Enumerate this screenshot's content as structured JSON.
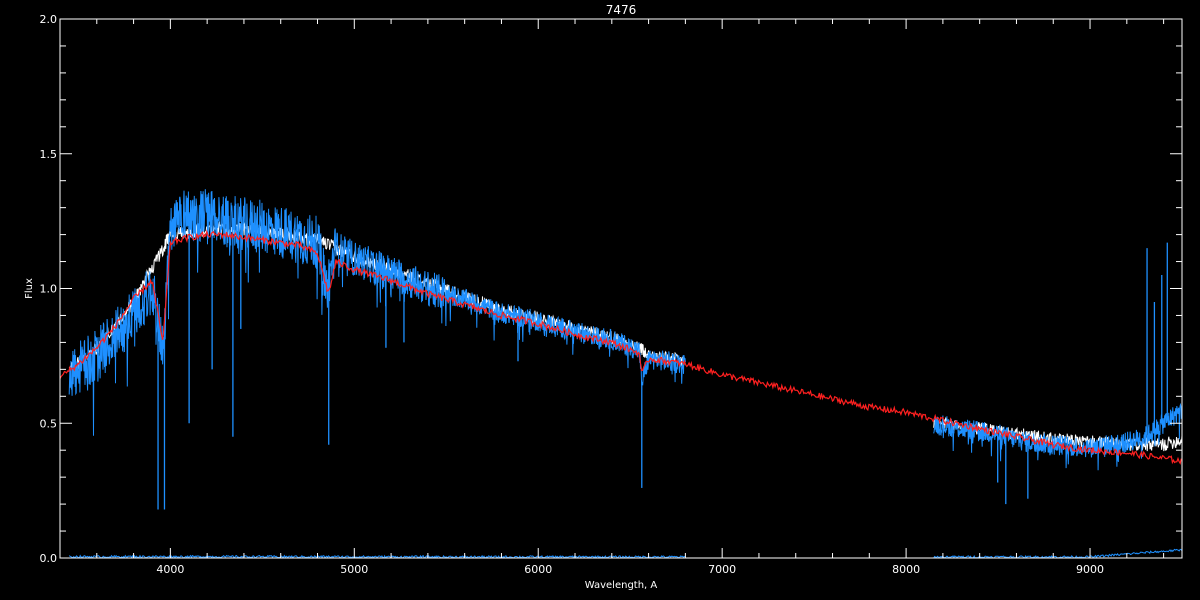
{
  "chart_data": {
    "type": "line",
    "title": "7476",
    "xlabel": "Wavelength, A",
    "ylabel": "Flux",
    "xlim": [
      3400,
      9500
    ],
    "ylim": [
      0.0,
      2.0
    ],
    "x_ticks": [
      4000,
      5000,
      6000,
      7000,
      8000,
      9000
    ],
    "x_tick_labels": [
      "4000",
      "5000",
      "6000",
      "7000",
      "8000",
      "9000"
    ],
    "y_ticks": [
      0.0,
      0.5,
      1.0,
      1.5,
      2.0
    ],
    "y_tick_labels": [
      "0.0",
      "0.5",
      "1.0",
      "1.5",
      "2.0"
    ],
    "grid": false,
    "colors": {
      "background": "#000000",
      "axes": "#ffffff",
      "observed": "#1e90ff",
      "model": "#ff2020",
      "white_spectrum": "#ffffff",
      "error": "#1e90ff"
    },
    "series": [
      {
        "style": "white",
        "segments": [
          {
            "x": [
              3450,
              3600,
              3800,
              4000,
              4200,
              4400,
              4600,
              4800,
              5000,
              5200,
              5400,
              5600,
              5800,
              6000,
              6200,
              6400,
              6550,
              6600,
              6700,
              6800
            ],
            "y": [
              0.7,
              0.78,
              0.95,
              1.2,
              1.22,
              1.22,
              1.2,
              1.18,
              1.12,
              1.07,
              1.02,
              0.97,
              0.92,
              0.89,
              0.85,
              0.82,
              0.78,
              0.75,
              0.74,
              0.73
            ]
          },
          {
            "x": [
              8150,
              8400,
              8600,
              8800,
              9000,
              9200,
              9400,
              9500
            ],
            "y": [
              0.5,
              0.48,
              0.46,
              0.44,
              0.43,
              0.42,
              0.42,
              0.44
            ]
          }
        ]
      },
      {
        "style": "blue",
        "segments": [
          {
            "x": [
              3450,
              3600,
              3800,
              3900,
              3960,
              4000,
              4050,
              4150,
              4200,
              4300,
              4400,
              4500,
              4600,
              4700,
              4800,
              4850,
              4900,
              5000,
              5200,
              5400,
              5600,
              5800,
              6000,
              6200,
              6400,
              6550,
              6562,
              6600,
              6700,
              6800
            ],
            "y": [
              0.68,
              0.75,
              0.9,
              1.0,
              0.78,
              1.2,
              1.28,
              1.27,
              1.28,
              1.25,
              1.24,
              1.23,
              1.21,
              1.19,
              1.17,
              1.0,
              1.15,
              1.11,
              1.06,
              1.0,
              0.96,
              0.91,
              0.88,
              0.84,
              0.81,
              0.77,
              0.65,
              0.74,
              0.73,
              0.72
            ]
          },
          {
            "x": [
              8150,
              8300,
              8498,
              8542,
              8600,
              8662,
              8700,
              8800,
              9000,
              9100,
              9200,
              9300,
              9400,
              9500
            ],
            "y": [
              0.5,
              0.48,
              0.46,
              0.45,
              0.44,
              0.43,
              0.43,
              0.42,
              0.41,
              0.42,
              0.43,
              0.45,
              0.5,
              0.55
            ]
          }
        ],
        "absorption_lines": [
          {
            "x": 3933,
            "y_min": 0.18
          },
          {
            "x": 3968,
            "y_min": 0.18
          },
          {
            "x": 4102,
            "y_min": 0.5
          },
          {
            "x": 4227,
            "y_min": 0.7
          },
          {
            "x": 4340,
            "y_min": 0.45
          },
          {
            "x": 4383,
            "y_min": 0.85
          },
          {
            "x": 4861,
            "y_min": 0.42
          },
          {
            "x": 5172,
            "y_min": 0.78
          },
          {
            "x": 5270,
            "y_min": 0.8
          },
          {
            "x": 5890,
            "y_min": 0.73
          },
          {
            "x": 6563,
            "y_min": 0.26
          },
          {
            "x": 8498,
            "y_min": 0.28
          },
          {
            "x": 8542,
            "y_min": 0.2
          },
          {
            "x": 8662,
            "y_min": 0.22
          }
        ],
        "emission_lines": [
          {
            "x": 9310,
            "y_max": 1.15
          },
          {
            "x": 9350,
            "y_max": 0.95
          },
          {
            "x": 9390,
            "y_max": 1.05
          },
          {
            "x": 9420,
            "y_max": 1.17
          }
        ]
      },
      {
        "style": "red",
        "segments": [
          {
            "x": [
              3400,
              3500,
              3600,
              3700,
              3800,
              3900,
              3960,
              4000,
              4100,
              4200,
              4300,
              4400,
              4500,
              4600,
              4700,
              4800,
              4860,
              4900,
              5000,
              5200,
              5400,
              5600,
              5800,
              6000,
              6200,
              6400,
              6550,
              6563,
              6600,
              6700,
              6800,
              7000,
              7200,
              7400,
              7600,
              7800,
              8000,
              8200,
              8400,
              8600,
              8800,
              9000,
              9200,
              9400,
              9500
            ],
            "y": [
              0.67,
              0.72,
              0.78,
              0.86,
              0.96,
              1.03,
              0.8,
              1.17,
              1.19,
              1.2,
              1.2,
              1.19,
              1.18,
              1.17,
              1.16,
              1.13,
              0.98,
              1.1,
              1.07,
              1.03,
              0.98,
              0.94,
              0.9,
              0.87,
              0.83,
              0.8,
              0.76,
              0.68,
              0.74,
              0.73,
              0.72,
              0.68,
              0.65,
              0.62,
              0.59,
              0.56,
              0.54,
              0.51,
              0.48,
              0.45,
              0.42,
              0.4,
              0.39,
              0.37,
              0.36
            ]
          }
        ]
      },
      {
        "style": "error",
        "segments": [
          {
            "x": [
              3450,
              4500,
              5500,
              6500,
              6800
            ],
            "y": [
              0.005,
              0.005,
              0.004,
              0.004,
              0.004
            ]
          },
          {
            "x": [
              8150,
              9000,
              9300,
              9500
            ],
            "y": [
              0.004,
              0.004,
              0.02,
              0.03
            ]
          }
        ]
      }
    ]
  }
}
